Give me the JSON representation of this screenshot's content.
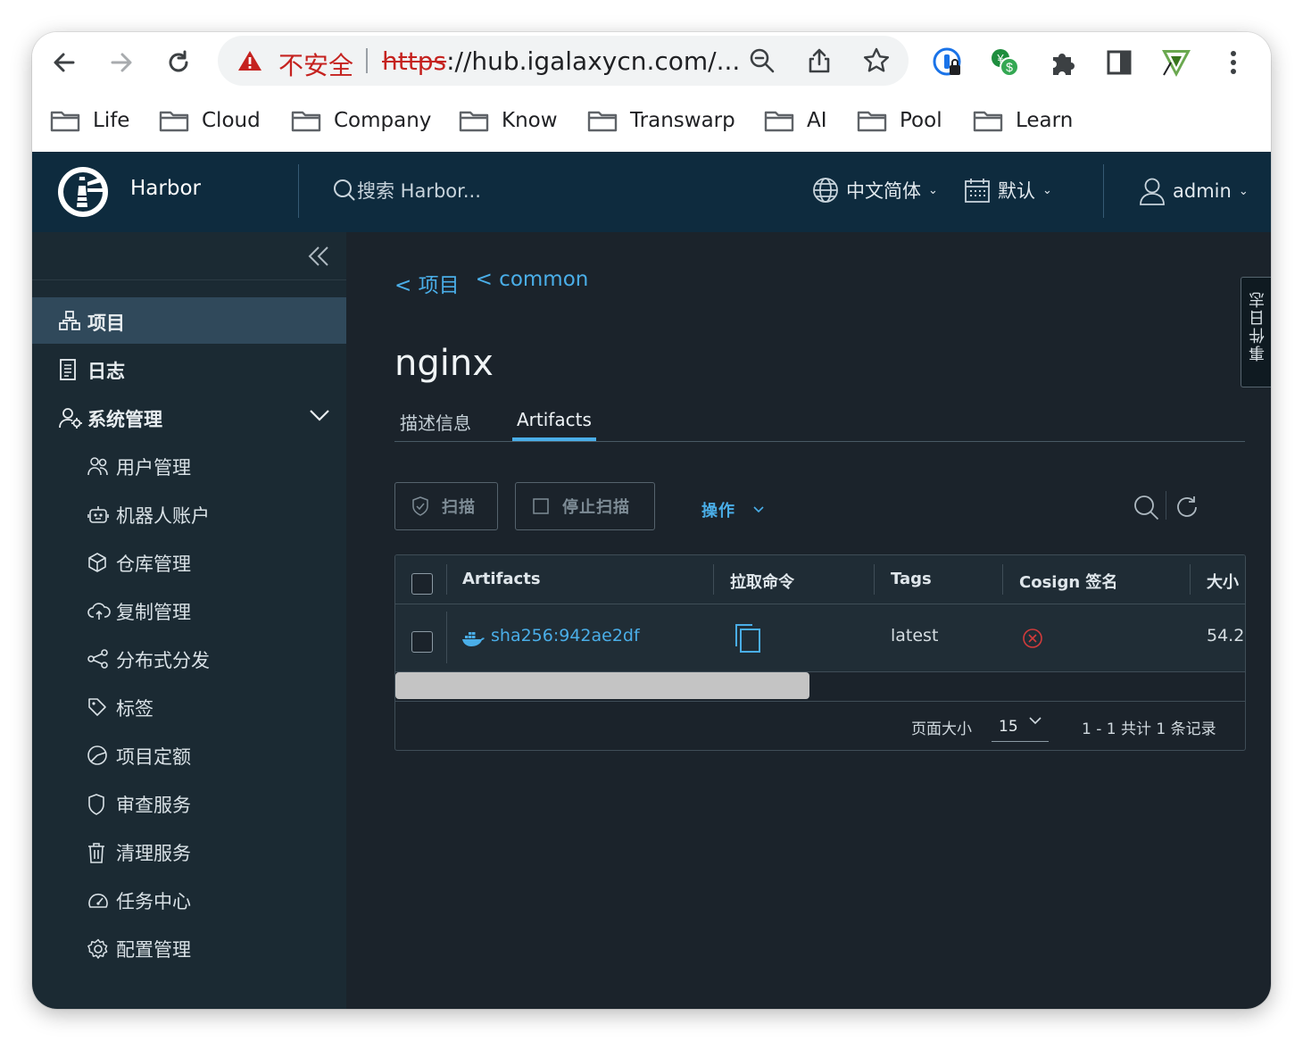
{
  "browser": {
    "security_label": "不安全",
    "url_scheme": "https",
    "url_rest": "://hub.igalaxycn.com/...",
    "bookmarks": [
      "Life",
      "Cloud",
      "Company",
      "Know",
      "Transwarp",
      "AI",
      "Pool",
      "Learn"
    ]
  },
  "header": {
    "brand": "Harbor",
    "search_placeholder": "搜索 Harbor...",
    "language": "中文简体",
    "date_format": "默认",
    "user": "admin"
  },
  "sidebar": {
    "items": [
      {
        "label": "项目",
        "icon": "projects-icon",
        "active": true
      },
      {
        "label": "日志",
        "icon": "logs-icon"
      },
      {
        "label": "系统管理",
        "icon": "admin-icon",
        "expanded": true
      }
    ],
    "sub_items": [
      {
        "label": "用户管理",
        "icon": "users-icon"
      },
      {
        "label": "机器人账户",
        "icon": "robot-icon"
      },
      {
        "label": "仓库管理",
        "icon": "registry-icon"
      },
      {
        "label": "复制管理",
        "icon": "cloud-replication-icon"
      },
      {
        "label": "分布式分发",
        "icon": "share-icon"
      },
      {
        "label": "标签",
        "icon": "tag-icon"
      },
      {
        "label": "项目定额",
        "icon": "quota-icon"
      },
      {
        "label": "审查服务",
        "icon": "shield-icon"
      },
      {
        "label": "清理服务",
        "icon": "trash-icon"
      },
      {
        "label": "任务中心",
        "icon": "dashboard-icon"
      },
      {
        "label": "配置管理",
        "icon": "gear-icon"
      }
    ]
  },
  "content": {
    "breadcrumbs": [
      "< 项目",
      "< common"
    ],
    "title": "nginx",
    "tabs": [
      "描述信息",
      "Artifacts"
    ],
    "active_tab": "Artifacts",
    "buttons": {
      "scan": "扫描",
      "stop_scan": "停止扫描",
      "actions": "操作"
    },
    "table": {
      "columns": [
        "Artifacts",
        "拉取命令",
        "Tags",
        "Cosign 签名",
        "大小"
      ],
      "rows": [
        {
          "artifact": "sha256:942ae2df",
          "tags": "latest",
          "cosign_signed": false,
          "size": "54.2"
        }
      ]
    },
    "footer": {
      "page_size_label": "页面大小",
      "page_size": "15",
      "summary": "1 - 1 共计 1 条记录"
    },
    "event_log_tab": "事件日志"
  },
  "colors": {
    "header_bg": "#0e2b3e",
    "sidebar_bg": "#1b2a33",
    "content_bg": "#1b232b",
    "accent": "#4aaee8",
    "insecure_red": "#c5221f"
  }
}
